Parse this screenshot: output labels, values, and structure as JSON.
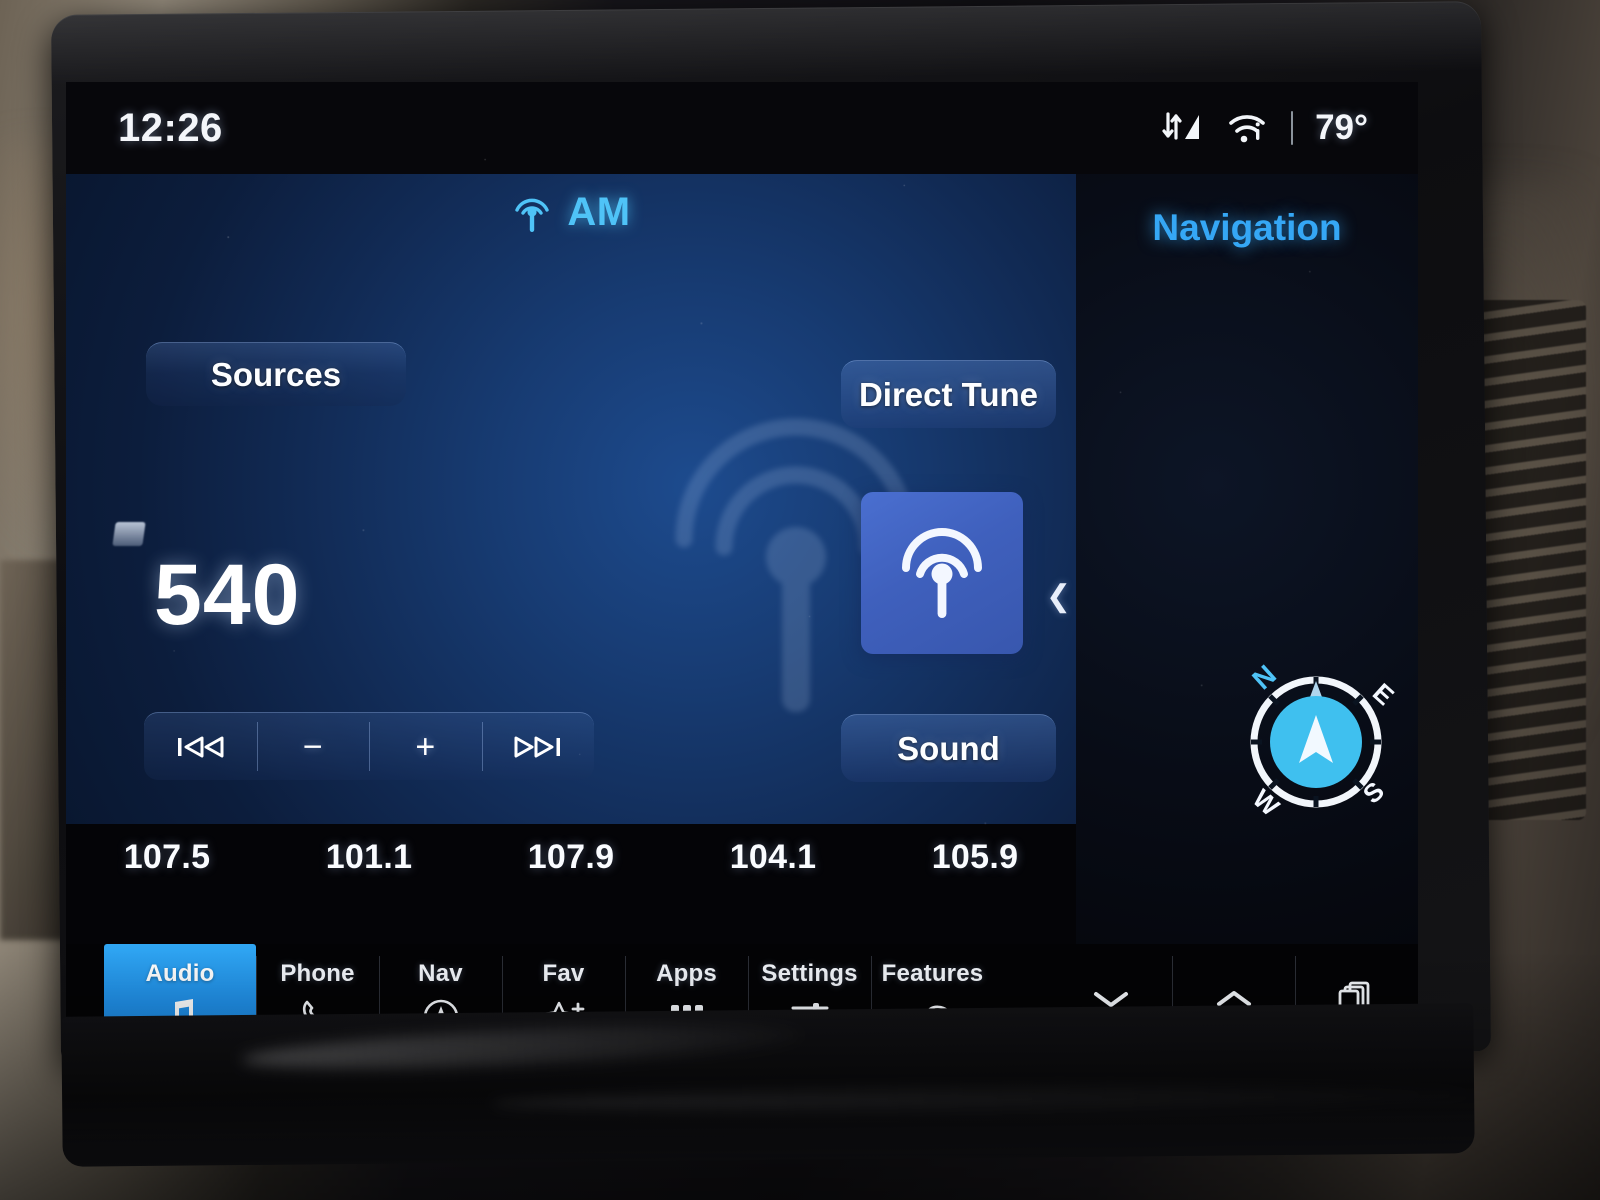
{
  "status_bar": {
    "clock": "12:26",
    "temperature": "79°",
    "data_icon": "data-transfer-signal-icon",
    "wifi_icon": "wifi-icon"
  },
  "audio": {
    "band_label": "AM",
    "band_icon": "broadcast-tower-icon",
    "frequency": "540",
    "sources_label": "Sources",
    "direct_tune_label": "Direct Tune",
    "sound_label": "Sound",
    "source_tile_icon": "broadcast-tower-icon",
    "carousel_next_icon": "chevron-left-icon",
    "transport": [
      {
        "name": "previous",
        "glyph": "⏮",
        "icon": "skip-previous-icon"
      },
      {
        "name": "seek-down",
        "glyph": "−",
        "icon": "minus-icon"
      },
      {
        "name": "seek-up",
        "glyph": "+",
        "icon": "plus-icon"
      },
      {
        "name": "next",
        "glyph": "⏭",
        "icon": "skip-next-icon"
      }
    ],
    "presets": [
      "107.5",
      "101.1",
      "107.9",
      "104.1",
      "105.9"
    ]
  },
  "navigation": {
    "title": "Navigation",
    "compass": {
      "north": "N",
      "east": "E",
      "south": "S",
      "west": "W"
    }
  },
  "page_indicator": {
    "pages": 2,
    "active_index": 1
  },
  "pager": {
    "active_index": 0,
    "dashes": 4
  },
  "navbar": {
    "items": [
      {
        "label": "Audio",
        "icon": "music-note-icon",
        "active": true
      },
      {
        "label": "Phone",
        "icon": "phone-handset-icon",
        "active": false
      },
      {
        "label": "Nav",
        "icon": "navigation-arrow-circle-icon",
        "active": false
      },
      {
        "label": "Fav",
        "icon": "star-plus-icon",
        "active": false
      },
      {
        "label": "Apps",
        "icon": "grid-apps-icon",
        "active": false
      },
      {
        "label": "Settings",
        "icon": "sliders-icon",
        "active": false
      },
      {
        "label": "Features",
        "icon": "car-icon",
        "active": false
      }
    ],
    "controls": [
      {
        "name": "collapse-down",
        "icon": "chevron-down-icon"
      },
      {
        "name": "expand-up",
        "icon": "chevron-up-icon"
      },
      {
        "name": "recent-apps",
        "icon": "stacked-cards-icon"
      }
    ]
  },
  "colors": {
    "accent_blue": "#35a7f5",
    "cyan": "#4fc3f7",
    "tile_blue": "#3f60bd",
    "active_tab": "#1f8fe8",
    "panel_bg": "#112a54",
    "screen_black": "#050508"
  }
}
